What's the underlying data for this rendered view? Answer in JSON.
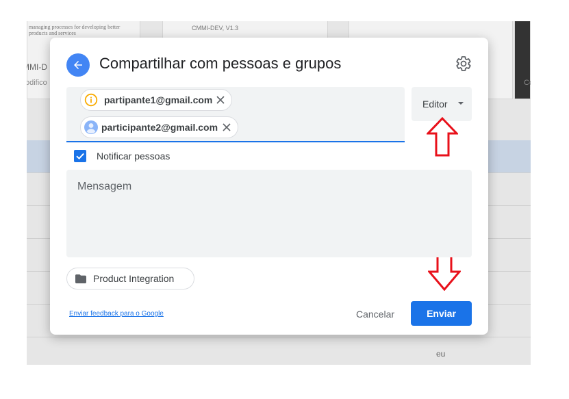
{
  "background": {
    "card1_thumb_text": "managing processes for developing better products and services",
    "card1_label": "MMI-D",
    "card1_sub": "odifico",
    "card2_thumb_text": "CMMI-DEV, V1.3",
    "card4_sub": "Co",
    "owner_cell": "eu"
  },
  "dialog": {
    "title": "Compartilhar com pessoas e grupos",
    "back_icon": "arrow-left-icon",
    "settings_icon": "gear-icon",
    "recipients": [
      {
        "email": "partipante1@gmail.com",
        "icon": "info-circle-icon",
        "icon_color": "#f9ab00"
      },
      {
        "email": "participante2@gmail.com",
        "icon": "person-avatar-icon",
        "icon_color": "#8ab4f8"
      }
    ],
    "role": {
      "label": "Editor"
    },
    "notify": {
      "label": "Notificar pessoas",
      "checked": true
    },
    "message": {
      "placeholder": "Mensagem"
    },
    "folder_chip": {
      "label": "Product Integration",
      "icon": "folder-icon"
    },
    "footer": {
      "feedback_link": "Enviar feedback para o Google",
      "cancel_label": "Cancelar",
      "send_label": "Enviar"
    }
  },
  "annotations": {
    "arrow_color": "#e8101a",
    "arrow_up_icon": "red-arrow-up-icon",
    "arrow_down_icon": "red-arrow-down-icon"
  },
  "colors": {
    "accent": "#1a73e8",
    "back_button": "#4285f4"
  }
}
